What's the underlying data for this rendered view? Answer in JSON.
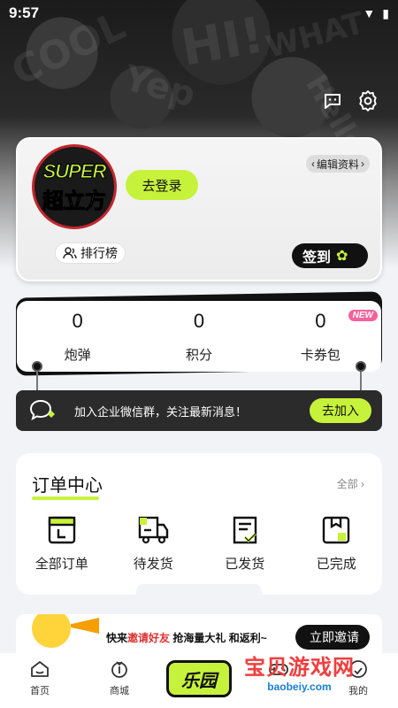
{
  "status_bar": {
    "time": "9:57"
  },
  "profile": {
    "avatar_line1": "SUPER",
    "avatar_line2": "超立方",
    "login_label": "去登录",
    "edit_label": "编辑资料",
    "ranking_label": "排行榜",
    "checkin_label": "签到"
  },
  "stats": [
    {
      "value": "0",
      "label": "炮弹"
    },
    {
      "value": "0",
      "label": "积分"
    },
    {
      "value": "0",
      "label": "卡券包"
    }
  ],
  "stats_badge": "NEW",
  "wechat": {
    "text": "加入企业微信群，关注最新消息！",
    "join_label": "去加入"
  },
  "orders": {
    "title": "订单中心",
    "all_label": "全部",
    "items": [
      {
        "label": "全部订单",
        "icon": "all-orders-icon"
      },
      {
        "label": "待发货",
        "icon": "truck-icon"
      },
      {
        "label": "已发货",
        "icon": "shipped-icon"
      },
      {
        "label": "已完成",
        "icon": "completed-icon"
      }
    ]
  },
  "invite": {
    "text_prefix": "快来",
    "text_highlight": "邀请好友",
    "text_suffix": " 抢海量大礼 和返利~",
    "button_label": "立即邀请"
  },
  "tabbar": {
    "home": "首页",
    "mall": "商城",
    "center": "乐园",
    "mine": "我的"
  },
  "watermark": {
    "big": "宝贝游戏网",
    "small": "baobeiy.com"
  },
  "colors": {
    "accent": "#c7f23b",
    "dark": "#111111",
    "badge": "#f4619b"
  }
}
